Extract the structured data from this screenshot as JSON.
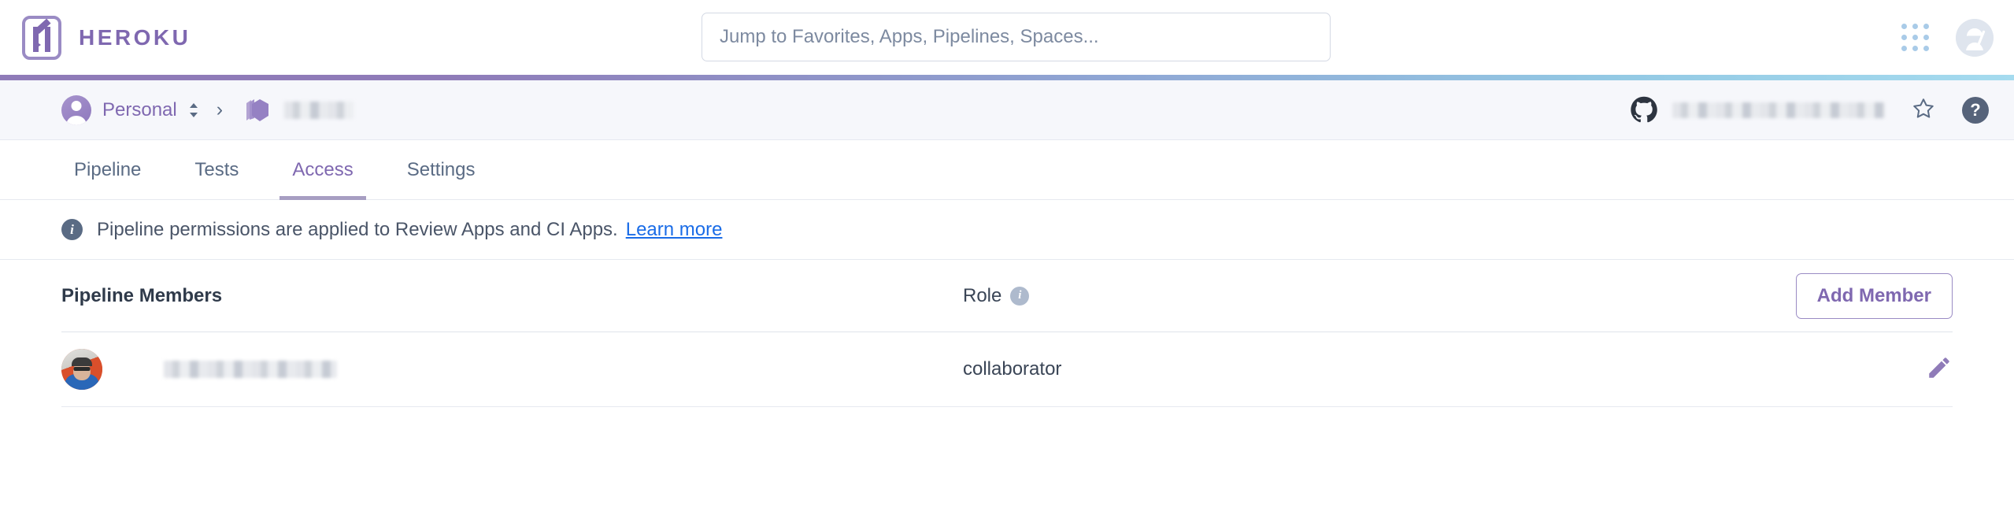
{
  "header": {
    "brand_name": "HEROKU",
    "logo_icon": "heroku-logo-icon",
    "search": {
      "placeholder": "Jump to Favorites, Apps, Pipelines, Spaces...",
      "value": ""
    },
    "apps_grid_icon": "app-grid-icon",
    "user_avatar_icon": "ninja-avatar-icon"
  },
  "breadcrumb": {
    "account_label": "Personal",
    "account_avatar_icon": "person-avatar-icon",
    "account_switcher_icon": "chevron-up-down-icon",
    "separator": "›",
    "pipeline_icon": "pipeline-stack-icon",
    "pipeline_name_redacted": "",
    "github_icon": "github-icon",
    "github_repo_redacted": "",
    "favorite_icon": "star-outline-icon",
    "help_icon": "help-question-icon",
    "help_label": "?"
  },
  "tabs": [
    {
      "label": "Pipeline",
      "active": false
    },
    {
      "label": "Tests",
      "active": false
    },
    {
      "label": "Access",
      "active": true
    },
    {
      "label": "Settings",
      "active": false
    }
  ],
  "notice": {
    "icon": "info-icon",
    "icon_glyph": "i",
    "text": "Pipeline permissions are applied to Review Apps and CI Apps.",
    "link_label": "Learn more"
  },
  "members_table": {
    "columns": {
      "members": "Pipeline Members",
      "role": "Role",
      "role_info_icon": "info-icon",
      "role_info_glyph": "i"
    },
    "add_member_label": "Add Member",
    "rows": [
      {
        "avatar_icon": "member-photo-avatar",
        "name_redacted": "",
        "role": "collaborator",
        "edit_icon": "pencil-edit-icon"
      }
    ]
  },
  "colors": {
    "brand_purple": "#7f68b0",
    "accent_gradient_start": "#8f7bb8",
    "accent_gradient_end": "#a5dbef",
    "link_blue": "#1a6ce7",
    "text_slate": "#5a6b84",
    "panel_bg": "#f6f7fb"
  }
}
